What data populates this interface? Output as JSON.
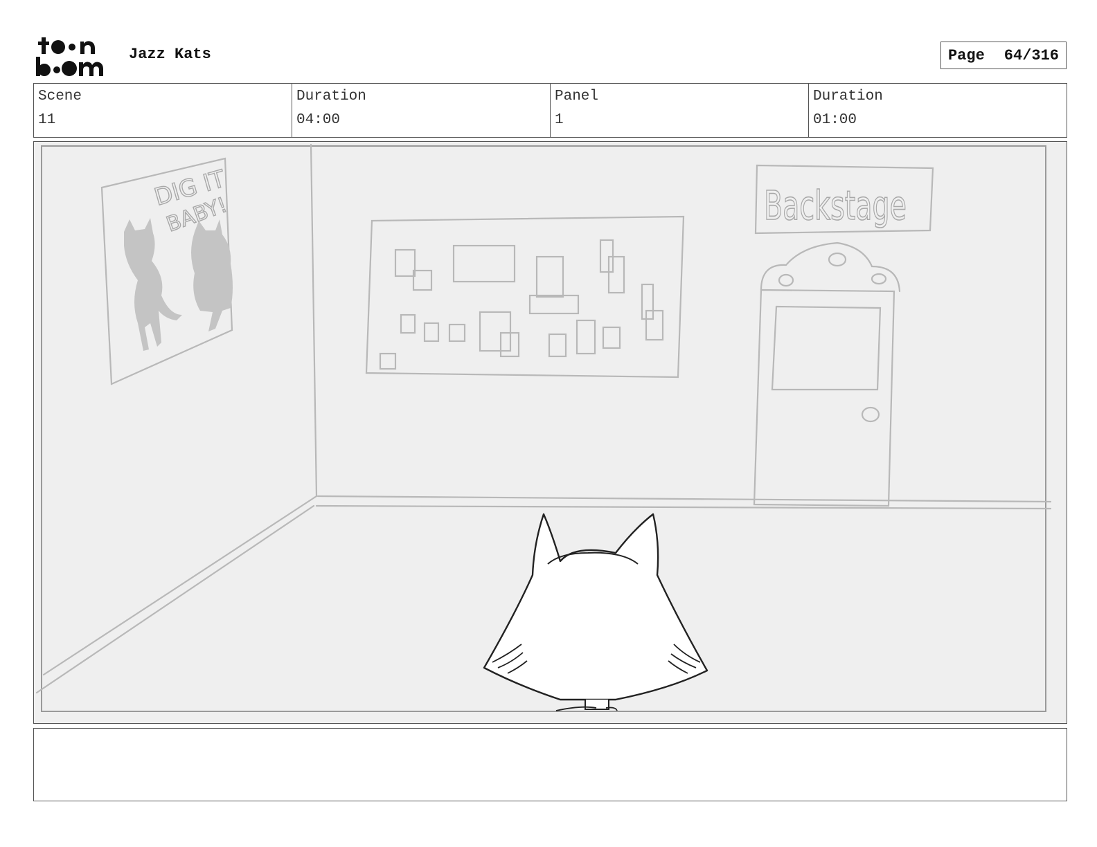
{
  "header": {
    "logo": {
      "alt": "toon boom",
      "icon": "toon-boom-logo"
    },
    "project_title": "Jazz Kats",
    "page_label": "Page",
    "page_value": "64/316"
  },
  "info": {
    "scene_label": "Scene",
    "scene_value": "11",
    "scene_duration_label": "Duration",
    "scene_duration_value": "04:00",
    "panel_label": "Panel",
    "panel_value": "1",
    "panel_duration_label": "Duration",
    "panel_duration_value": "01:00"
  },
  "panel_drawing": {
    "poster_text_1": "DIG IT",
    "poster_text_2": "BABY!",
    "sign_text": "Backstage",
    "colors": {
      "background": "#efefef",
      "sketch": "#b5b5b5",
      "character_line": "#222222"
    }
  },
  "notes": {
    "text": ""
  }
}
